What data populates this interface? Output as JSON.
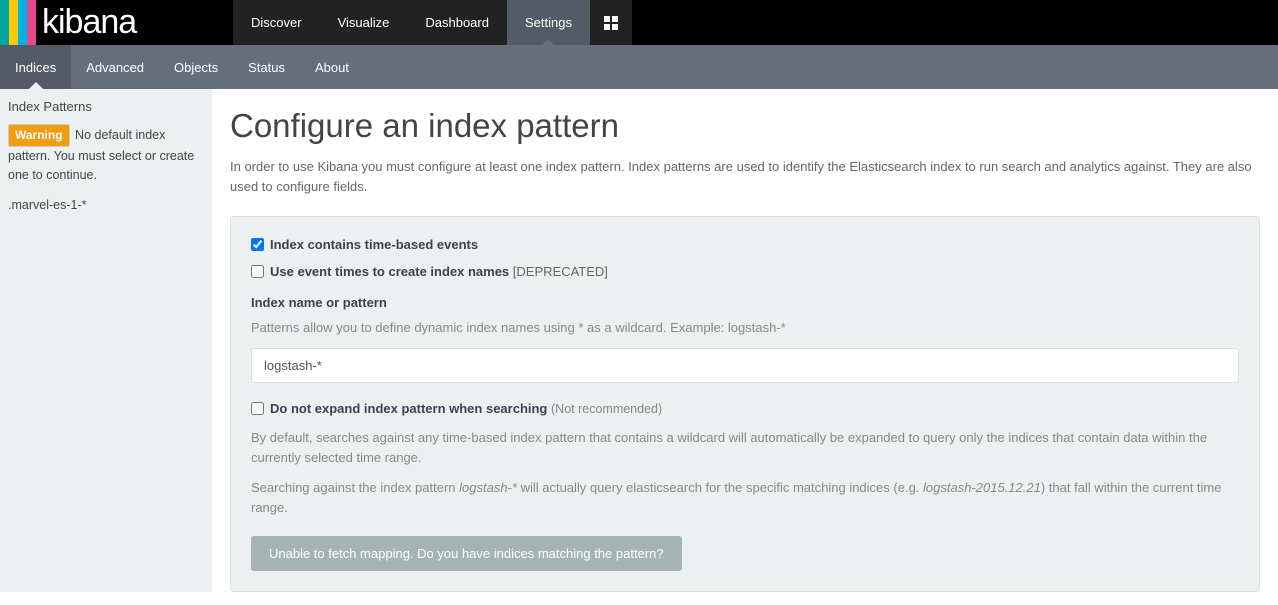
{
  "logo": {
    "text": "kibana",
    "stripe_colors": [
      "#00a69b",
      "#ffcb05",
      "#00b3e3",
      "#e8478b"
    ]
  },
  "topnav": [
    {
      "label": "Discover",
      "active": false
    },
    {
      "label": "Visualize",
      "active": false
    },
    {
      "label": "Dashboard",
      "active": false
    },
    {
      "label": "Settings",
      "active": true
    }
  ],
  "subnav": [
    {
      "label": "Indices",
      "active": true
    },
    {
      "label": "Advanced",
      "active": false
    },
    {
      "label": "Objects",
      "active": false
    },
    {
      "label": "Status",
      "active": false
    },
    {
      "label": "About",
      "active": false
    }
  ],
  "sidebar": {
    "title": "Index Patterns",
    "warning_badge": "Warning",
    "warning_text": "No default index pattern. You must select or create one to continue.",
    "patterns": [
      ".marvel-es-1-*"
    ]
  },
  "main": {
    "heading": "Configure an index pattern",
    "intro": "In order to use Kibana you must configure at least one index pattern. Index patterns are used to identify the Elasticsearch index to run search and analytics against. They are also used to configure fields.",
    "checkbox_time_events": {
      "checked": true,
      "label": "Index contains time-based events"
    },
    "checkbox_event_times": {
      "checked": false,
      "label": "Use event times to create index names",
      "suffix": "[DEPRECATED]"
    },
    "index_name_label": "Index name or pattern",
    "index_name_help": "Patterns allow you to define dynamic index names using * as a wildcard. Example: logstash-*",
    "index_name_value": "logstash-*",
    "checkbox_no_expand": {
      "checked": false,
      "label": "Do not expand index pattern when searching",
      "suffix": "(Not recommended)"
    },
    "expand_help_1_a": "By default, searches against any time-based index pattern that contains a wildcard will automatically be expanded to query only the indices that contain data within the currently selected time range.",
    "expand_help_2_a": "Searching against the index pattern ",
    "expand_help_2_em1": "logstash-*",
    "expand_help_2_b": " will actually query elasticsearch for the specific matching indices (e.g. ",
    "expand_help_2_em2": "logstash-2015.12.21",
    "expand_help_2_c": ") that fall within the current time range.",
    "button_label": "Unable to fetch mapping. Do you have indices matching the pattern?"
  }
}
